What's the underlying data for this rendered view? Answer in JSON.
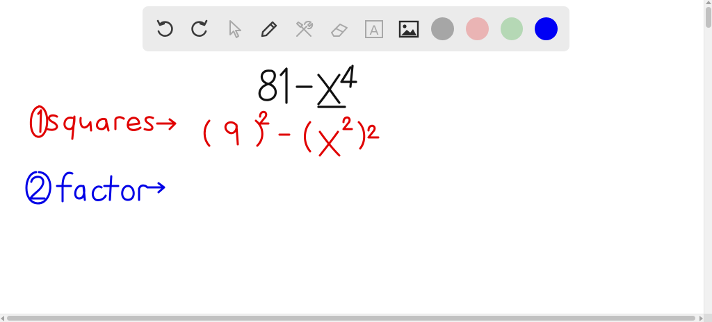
{
  "toolbar": {
    "tools": [
      {
        "name": "undo-icon",
        "enabled": true
      },
      {
        "name": "redo-icon",
        "enabled": true
      },
      {
        "name": "select-pointer-icon",
        "enabled": false
      },
      {
        "name": "pen-icon",
        "enabled": true
      },
      {
        "name": "tools-icon",
        "enabled": false
      },
      {
        "name": "eraser-icon",
        "enabled": false
      },
      {
        "name": "text-box-icon",
        "enabled": false
      },
      {
        "name": "image-icon",
        "enabled": true
      }
    ],
    "text_tool_glyph": "A",
    "colors": {
      "gray": "#a6a6a6",
      "pink": "#eab4b4",
      "green": "#b5d8b5",
      "blue": "#0000f5"
    }
  },
  "ink": {
    "black": "#111111",
    "red": "#e00000",
    "blue": "#0000e6"
  }
}
